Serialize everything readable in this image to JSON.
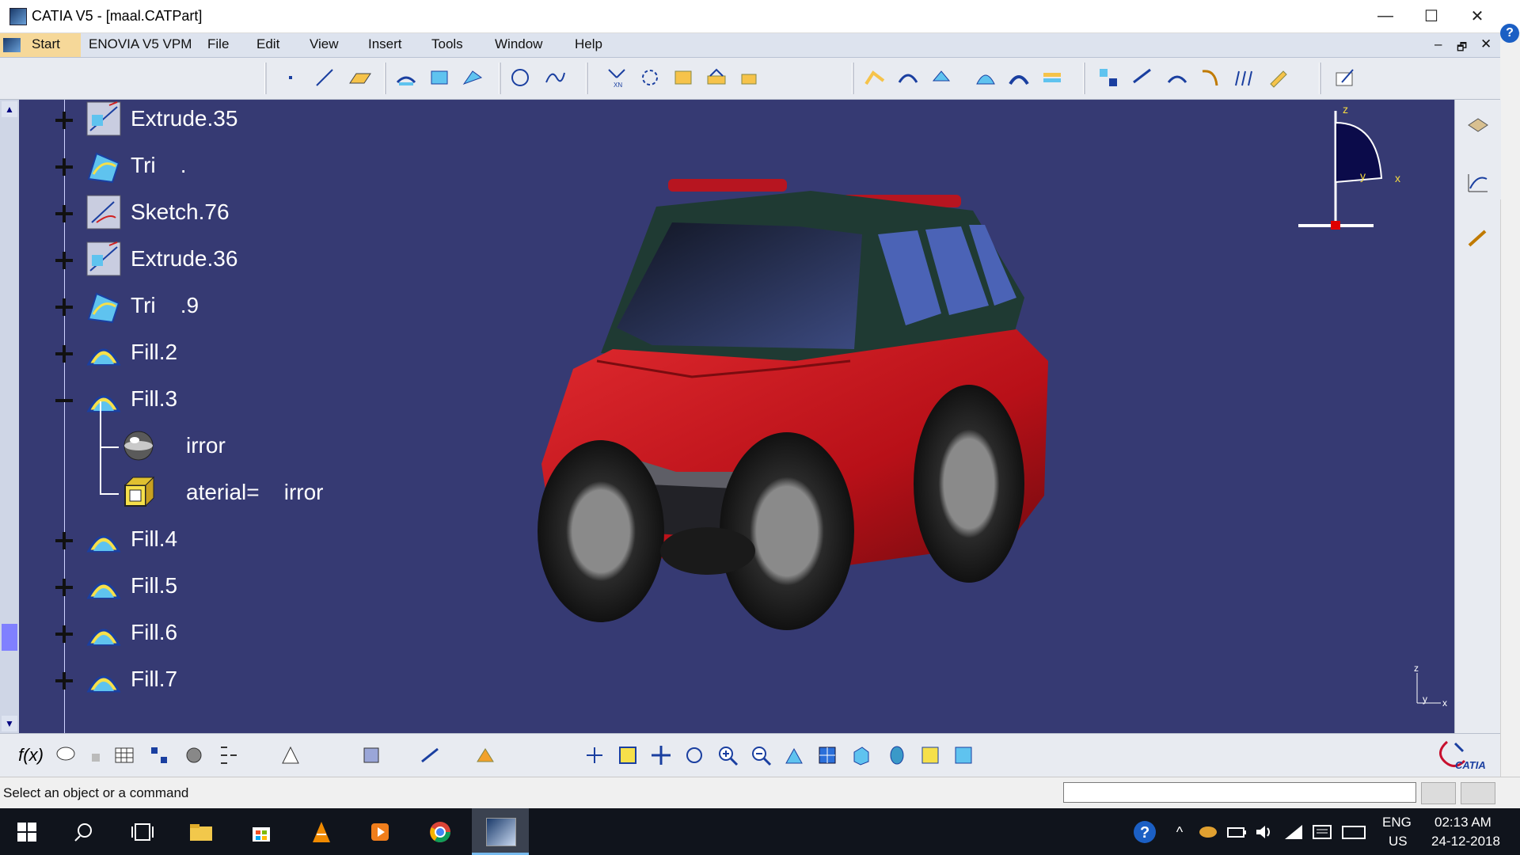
{
  "window": {
    "title": "CATIA V5 - [maal.CATPart]",
    "controls": {
      "minimize": "—",
      "maximize": "☐",
      "close": "✕"
    }
  },
  "menubar": {
    "start": "Start",
    "items": [
      "ENOVIA V5 VPM",
      "File",
      "Edit",
      "View",
      "Insert",
      "Tools",
      "Window",
      "Help"
    ],
    "doc_controls": {
      "minimize": "–",
      "restore": "🗗",
      "close": "✕"
    }
  },
  "tree": {
    "nodes": [
      {
        "label": "Extrude.35",
        "icon": "extrude-icon",
        "expander": "plus"
      },
      {
        "label": "Tri    .",
        "icon": "trim-icon",
        "expander": "plus"
      },
      {
        "label": "Sketch.76",
        "icon": "sketch-icon",
        "expander": "plus"
      },
      {
        "label": "Extrude.36",
        "icon": "extrude-icon",
        "expander": "plus"
      },
      {
        "label": "Tri    .9",
        "icon": "trim-icon",
        "expander": "plus"
      },
      {
        "label": "Fill.2",
        "icon": "fill-icon",
        "expander": "plus"
      },
      {
        "label": "Fill.3",
        "icon": "fill-icon",
        "expander": "minus"
      },
      {
        "label": "irror",
        "icon": "mirror-material-sphere-icon",
        "expander": "none",
        "child": true
      },
      {
        "label": "aterial=    irror",
        "icon": "material-box-icon",
        "expander": "none",
        "child": true
      },
      {
        "label": "Fill.4",
        "icon": "fill-icon",
        "expander": "plus"
      },
      {
        "label": "Fill.5",
        "icon": "fill-icon",
        "expander": "plus"
      },
      {
        "label": "Fill.6",
        "icon": "fill-icon",
        "expander": "plus"
      },
      {
        "label": "Fill.7",
        "icon": "fill-icon",
        "expander": "plus"
      }
    ]
  },
  "compass": {
    "z": "z",
    "y": "y",
    "x": "x"
  },
  "axis_triad": {
    "z": "z",
    "y": "y",
    "x": "x"
  },
  "brand": {
    "logo": "CATIA"
  },
  "status": {
    "message": "Select an object or a command",
    "command_input": ""
  },
  "taskbar": {
    "lang_top": "ENG",
    "lang_bottom": "US",
    "time": "02:13 AM",
    "date": "24-12-2018"
  },
  "colors": {
    "viewport_bg": "#363a73",
    "car_body": "#c4141d",
    "accent_start": "#f6d899"
  }
}
